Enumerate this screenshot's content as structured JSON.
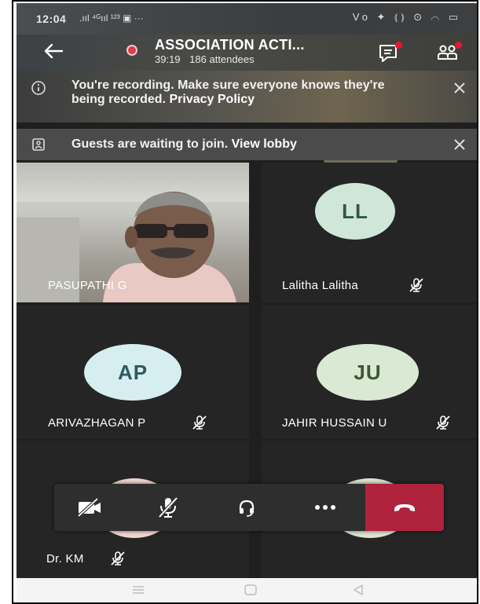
{
  "status_bar": {
    "time": "12:04",
    "left_icons": ".ııl ⁴ᴳııl ¹²³ ▣ ···",
    "right_icons": "Vo ✦ ⦅⦆ ⊙ ⌒ ▭"
  },
  "header": {
    "title": "ASSOCIATION ACTI...",
    "duration": "39:19",
    "attendees": "186 attendees"
  },
  "banners": {
    "recording": {
      "text": "You're recording. Make sure everyone knows they're being recorded.",
      "link": "Privacy Policy"
    },
    "lobby": {
      "text": "Guests are waiting to join.",
      "link": "View lobby"
    }
  },
  "participants": [
    {
      "name": "PASUPATHI G",
      "initials": "",
      "video": true,
      "muted": false
    },
    {
      "name": "Lalitha Lalitha",
      "initials": "LL",
      "muted": true,
      "avatar_bg": "#cfe6d8",
      "avatar_fg": "#2f5a40"
    },
    {
      "name": "ARIVAZHAGAN P",
      "initials": "AP",
      "muted": true,
      "avatar_bg": "#d6eef0",
      "avatar_fg": "#2c5a60"
    },
    {
      "name": "JAHIR HUSSAIN U",
      "initials": "JU",
      "muted": true,
      "avatar_bg": "#d9e9d3",
      "avatar_fg": "#3b5a2f"
    },
    {
      "name": "Dr. KM",
      "initials": "",
      "muted": true,
      "avatar_bg": "#f2d6cf"
    },
    {
      "name": "",
      "initials": "",
      "muted": false,
      "avatar_bg": "#dde6cf"
    }
  ],
  "colors": {
    "recording_dot": "#e03c4b",
    "hangup": "#b0233c",
    "notification": "#e8162e"
  },
  "icons": {
    "back": "arrow-left-icon",
    "chat": "chat-icon",
    "people": "people-icon",
    "info": "info-icon",
    "lobby": "lobby-icon",
    "close": "close-icon",
    "camera_off": "camera-off-icon",
    "mic_off": "mic-off-icon",
    "audio": "headset-icon",
    "more": "more-icon",
    "hangup": "hang-up-icon"
  }
}
